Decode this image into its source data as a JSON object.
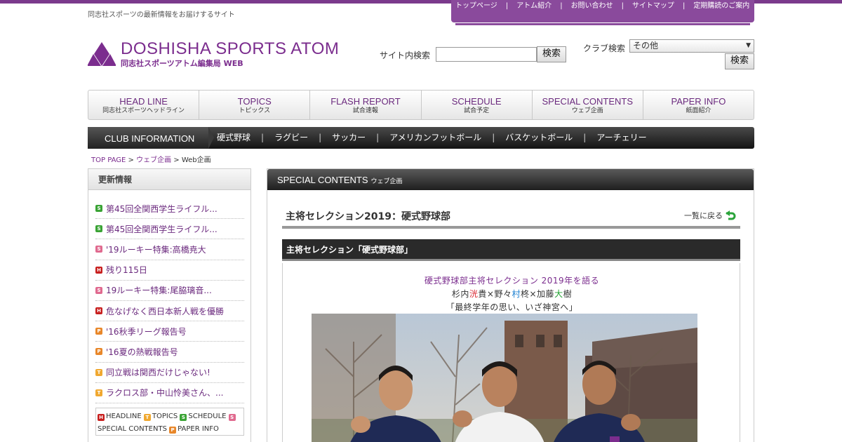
{
  "tagline": "同志社スポーツの最新情報をお届けするサイト",
  "top_nav": {
    "items": [
      "トップページ",
      "アトム紹介",
      "お問い合わせ",
      "サイトマップ",
      "定期購読のご案内"
    ],
    "separator": "|"
  },
  "logo": {
    "title": "DOSHISHA SPORTS ATOM",
    "subtitle": "同志社スポーツアトム編集局 WEB"
  },
  "site_search": {
    "label": "サイト内検索",
    "value": "",
    "button": "検索"
  },
  "club_search": {
    "label": "クラブ検索",
    "selected": "その他",
    "button": "検索"
  },
  "main_nav": [
    {
      "en": "HEAD LINE",
      "jp": "同志社スポーツヘッドライン"
    },
    {
      "en": "TOPICS",
      "jp": "トピックス"
    },
    {
      "en": "FLASH REPORT",
      "jp": "試合速報"
    },
    {
      "en": "SCHEDULE",
      "jp": "試合予定"
    },
    {
      "en": "SPECIAL CONTENTS",
      "jp": "ウェブ企画"
    },
    {
      "en": "PAPER INFO",
      "jp": "紙面紹介"
    }
  ],
  "club_bar": {
    "label": "CLUB INFORMATION",
    "links": [
      "硬式野球",
      "ラグビー",
      "サッカー",
      "アメリカンフットボール",
      "バスケットボール",
      "アーチェリー"
    ],
    "separator": "|"
  },
  "breadcrumb": {
    "home": "TOP PAGE",
    "sep1": ">",
    "parent": "ウェブ企画",
    "sep2": ">",
    "current": "Web企画"
  },
  "sidebar": {
    "title": "更新情報",
    "updates": [
      {
        "badge": "S",
        "badge_color": "#3aa335",
        "text": "第45回全関西学生ライフル..."
      },
      {
        "badge": "S",
        "badge_color": "#3aa335",
        "text": "第45回全関西学生ライフル..."
      },
      {
        "badge": "S",
        "badge_color": "#e06a8f",
        "text": "'19ルーキー特集:高橋尭大"
      },
      {
        "badge": "H",
        "badge_color": "#c8201f",
        "text": "残り115日"
      },
      {
        "badge": "S",
        "badge_color": "#e06a8f",
        "text": "19ルーキー特集:尾脇璃音..."
      },
      {
        "badge": "H",
        "badge_color": "#c8201f",
        "text": "危なげなく西日本新人戦を優勝"
      },
      {
        "badge": "P",
        "badge_color": "#e8872a",
        "text": "'16秋季リーグ報告号"
      },
      {
        "badge": "P",
        "badge_color": "#e8872a",
        "text": "'16夏の熱戦報告号"
      },
      {
        "badge": "T",
        "badge_color": "#f0a830",
        "text": "同立戦は関西だけじゃない!"
      },
      {
        "badge": "T",
        "badge_color": "#f0a830",
        "text": "ラクロス部・中山怜美さん、..."
      }
    ],
    "legend": [
      {
        "badge": "H",
        "badge_color": "#c8201f",
        "label": "HEADLINE"
      },
      {
        "badge": "T",
        "badge_color": "#f0a830",
        "label": "TOPICS"
      },
      {
        "badge": "S",
        "badge_color": "#3aa335",
        "label": "SCHEDULE"
      },
      {
        "badge": "S",
        "badge_color": "#e06a8f",
        "label": "SPECIAL CONTENTS"
      },
      {
        "badge": "P",
        "badge_color": "#e8872a",
        "label": "PAPER INFO"
      }
    ]
  },
  "content": {
    "header_en": "SPECIAL CONTENTS",
    "header_jp": "ウェブ企画",
    "title": "主将セレクション2019：硬式野球部",
    "back_link": "一覧に戻る",
    "section_title": "主将セレクション「硬式野球部」",
    "lead1": "硬式野球部主将セレクション 2019年を語る",
    "lead2": {
      "a": "杉内",
      "b": "洸",
      "c": "貴×野々",
      "d": "村",
      "e": "柊×加藤",
      "f": "大",
      "g": "樹"
    },
    "lead3": "「最終学年の思い、いざ神宮へ」"
  },
  "colors": {
    "brand": "#7b2d8e",
    "topbar": "#7b3a8c"
  }
}
